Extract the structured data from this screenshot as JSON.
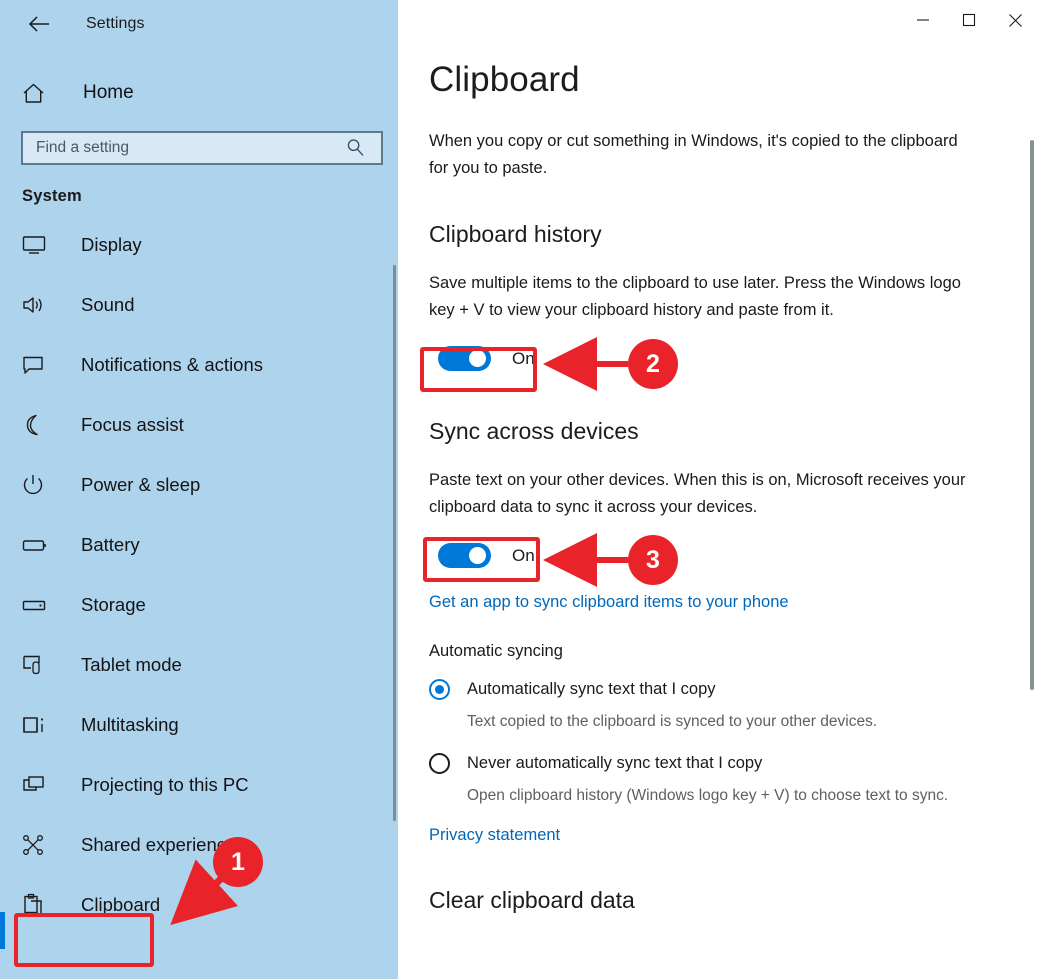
{
  "window": {
    "app_title": "Settings",
    "back_icon": "back-arrow-icon",
    "controls": {
      "minimize": "minimize-icon",
      "maximize": "maximize-icon",
      "close": "close-icon"
    }
  },
  "sidebar": {
    "home": {
      "label": "Home",
      "icon": "home-icon"
    },
    "search": {
      "placeholder": "Find a setting",
      "value": "",
      "icon": "search-icon"
    },
    "section_header": "System",
    "items": [
      {
        "label": "Display",
        "icon": "monitor-icon",
        "selected": false
      },
      {
        "label": "Sound",
        "icon": "speaker-icon",
        "selected": false
      },
      {
        "label": "Notifications & actions",
        "icon": "chat-bubble-icon",
        "selected": false
      },
      {
        "label": "Focus assist",
        "icon": "moon-icon",
        "selected": false
      },
      {
        "label": "Power & sleep",
        "icon": "power-icon",
        "selected": false
      },
      {
        "label": "Battery",
        "icon": "battery-icon",
        "selected": false
      },
      {
        "label": "Storage",
        "icon": "drive-icon",
        "selected": false
      },
      {
        "label": "Tablet mode",
        "icon": "tablet-icon",
        "selected": false
      },
      {
        "label": "Multitasking",
        "icon": "multitask-icon",
        "selected": false
      },
      {
        "label": "Projecting to this PC",
        "icon": "project-screen-icon",
        "selected": false
      },
      {
        "label": "Shared experiences",
        "icon": "share-nodes-icon",
        "selected": false
      },
      {
        "label": "Clipboard",
        "icon": "clipboard-icon",
        "selected": true
      }
    ]
  },
  "main": {
    "page_title": "Clipboard",
    "intro": "When you copy or cut something in Windows, it's copied to the clipboard for you to paste.",
    "clipboard_history": {
      "heading": "Clipboard history",
      "description": "Save multiple items to the clipboard to use later. Press the Windows logo key + V to view your clipboard history and paste from it.",
      "toggle_state": "On"
    },
    "sync_across_devices": {
      "heading": "Sync across devices",
      "description": "Paste text on your other devices. When this is on, Microsoft receives your clipboard data to sync it across your devices.",
      "toggle_state": "On",
      "link": "Get an app to sync clipboard items to your phone"
    },
    "automatic_syncing": {
      "label": "Automatic syncing",
      "options": [
        {
          "label": "Automatically sync text that I copy",
          "hint": "Text copied to the clipboard is synced to your other devices.",
          "selected": true
        },
        {
          "label": "Never automatically sync text that I copy",
          "hint": "Open clipboard history (Windows logo key + V) to choose text to sync.",
          "selected": false
        }
      ]
    },
    "privacy_link": "Privacy statement",
    "clear_clipboard_heading": "Clear clipboard data"
  },
  "annotations": {
    "accent_color": "#e8242a",
    "markers": [
      {
        "number": "1",
        "target": "sidebar-item-clipboard"
      },
      {
        "number": "2",
        "target": "clipboard-history-toggle"
      },
      {
        "number": "3",
        "target": "sync-across-devices-toggle"
      }
    ]
  },
  "colors": {
    "sidebar_bg": "#aed3ec",
    "accent_blue": "#0078d7",
    "link_blue": "#0067b8",
    "annotation_red": "#e8242a"
  }
}
